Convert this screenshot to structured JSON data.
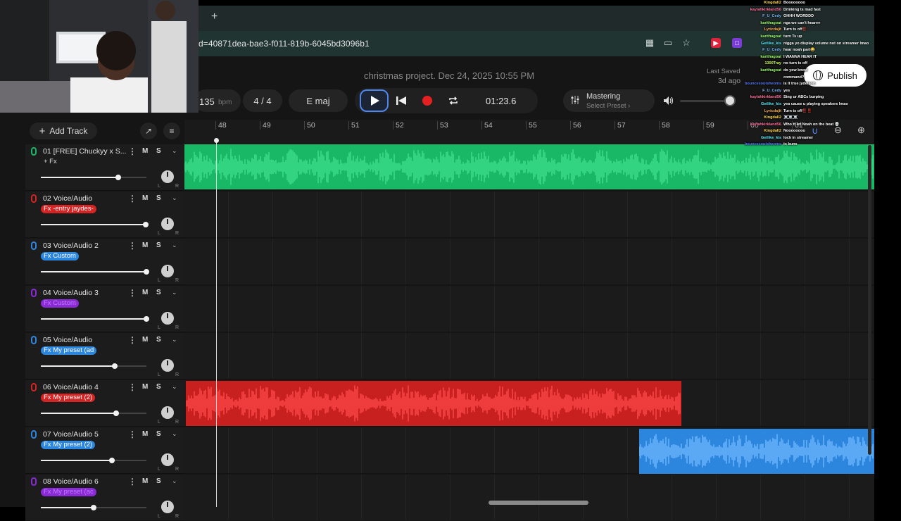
{
  "browser": {
    "new_tab_symbol": "+",
    "url_text": "d=40871dea-bae3-f011-819b-6045bd3096b1"
  },
  "header": {
    "project_title": "christmas project. Dec 24, 2025 10:55 PM",
    "last_saved_label": "Last Saved",
    "last_saved_value": "3d ago",
    "publish_label": "Publish"
  },
  "transport": {
    "bpm": "135",
    "bpm_unit": "bpm",
    "time_signature": "4 / 4",
    "key": "E maj",
    "time": "01:23.6",
    "mastering_label": "Mastering",
    "mastering_preset": "Select Preset",
    "volume_level": 0.95
  },
  "toolbar": {
    "add_track_label": "Add Track"
  },
  "ruler": {
    "bars": [
      "48",
      "49",
      "50",
      "51",
      "52",
      "53",
      "54",
      "55",
      "56",
      "57",
      "58",
      "59",
      "60",
      "61"
    ]
  },
  "tracks": [
    {
      "name": "01  [FREE] Chuckyy x S...",
      "fx_label": "+ Fx",
      "fx_style": "plain",
      "mic_color": "#19b866",
      "volume": 0.73
    },
    {
      "name": "02  Voice/Audio",
      "fx_label": "Fx -entry jaydes-",
      "fx_style": "red",
      "mic_color": "#d52424",
      "volume": 0.99
    },
    {
      "name": "03  Voice/Audio 2",
      "fx_label": "Fx Custom",
      "fx_style": "blue",
      "mic_color": "#2d86de",
      "volume": 1.0
    },
    {
      "name": "04  Voice/Audio 3",
      "fx_label": "Fx Custom",
      "fx_style": "purple",
      "mic_color": "#8a2bd6",
      "volume": 1.0
    },
    {
      "name": "05  Voice/Audio",
      "fx_label": "Fx My preset (ad",
      "fx_style": "blue",
      "mic_color": "#2d86de",
      "volume": 0.7
    },
    {
      "name": "06  Voice/Audio 4",
      "fx_label": "Fx My preset (2)",
      "fx_style": "red",
      "mic_color": "#d52424",
      "volume": 0.71
    },
    {
      "name": "07  Voice/Audio 5",
      "fx_label": "Fx My preset (2)",
      "fx_style": "blue",
      "mic_color": "#2d86de",
      "volume": 0.67
    },
    {
      "name": "08  Voice/Audio 6",
      "fx_label": "Fx My preset (ac",
      "fx_style": "purple",
      "mic_color": "#8a2bd6",
      "volume": 0.5
    }
  ],
  "mute_label": "M",
  "solo_label": "S",
  "pan_left": "L",
  "pan_right": "R",
  "chat": [
    {
      "user": "Kingdall2",
      "color": "#ffd84a",
      "msg": "Boooooooo"
    },
    {
      "user": "kaylahkirkland56",
      "color": "#ff6f9a",
      "msg": "Drinking ts mad fast"
    },
    {
      "user": "F_U_Cedy",
      "color": "#7ab8ff",
      "msg": "OHHH WORDDD"
    },
    {
      "user": "karithagoat",
      "color": "#9eff6a",
      "msg": "nga we can't hearrrr"
    },
    {
      "user": "Lyricdajit",
      "color": "#ffb347",
      "msg": "Turn ts off‼️"
    },
    {
      "user": "karithagoat",
      "color": "#9eff6a",
      "msg": "turn Ts up"
    },
    {
      "user": "Getlike_kis",
      "color": "#5cf0ff",
      "msg": "nigga yo display volume not on streamer lmao"
    },
    {
      "user": "F_U_Cedy",
      "color": "#7ab8ff",
      "msg": "hear noah part😂"
    },
    {
      "user": "karithagoat",
      "color": "#9eff6a",
      "msg": "I WANNA HEAR IT"
    },
    {
      "user": "1300Tray",
      "color": "#d0ff4a",
      "msg": "no turn ts off"
    },
    {
      "user": "karithagoat",
      "color": "#9eff6a",
      "msg": "do yew know"
    },
    {
      "user": "",
      "color": "#9eff6a",
      "msg": "command?"
    },
    {
      "user": "bouncesoutsheoms",
      "color": "#5a7bff",
      "msg": "is it true jydeleon"
    },
    {
      "user": "F_U_Cedy",
      "color": "#7ab8ff",
      "msg": "yes"
    },
    {
      "user": "kaylahkirkland56",
      "color": "#ff6f9a",
      "msg": "Sing ur ABCs burping"
    },
    {
      "user": "Getlike_kis",
      "color": "#5cf0ff",
      "msg": "yea cause u playing speakers lmao"
    },
    {
      "user": "Lyricdajit",
      "color": "#ffb347",
      "msg": "Turn ts off‼️‼️"
    },
    {
      "user": "Kingdall2",
      "color": "#ffd84a",
      "msg": "☠️☠️☠️"
    },
    {
      "user": "kaylahkirkland56",
      "color": "#ff6f9a",
      "msg": "Who tf let Noah on the beat 💀"
    },
    {
      "user": "Kingdall2",
      "color": "#ffd84a",
      "msg": "Noooooooo"
    },
    {
      "user": "Getlike_kis",
      "color": "#5cf0ff",
      "msg": "lock in streamer"
    },
    {
      "user": "bouncesoutsheoms",
      "color": "#5a7bff",
      "msg": "ts buns"
    }
  ]
}
